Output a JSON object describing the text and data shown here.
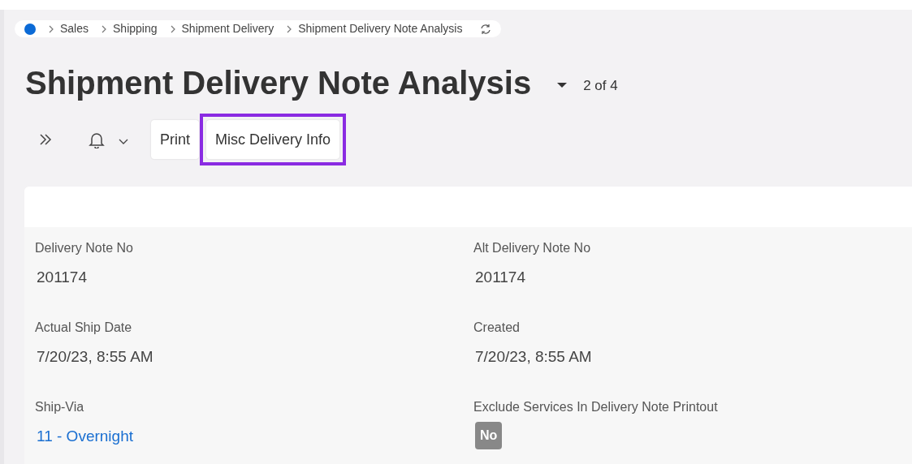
{
  "breadcrumb": [
    "Sales",
    "Shipping",
    "Shipment Delivery",
    "Shipment Delivery Note Analysis"
  ],
  "title": "Shipment Delivery Note Analysis",
  "record_position": "2 of 4",
  "toolbar": {
    "buttons": [
      {
        "label": "Print",
        "highlighted": false
      },
      {
        "label": "Misc Delivery Info",
        "highlighted": true
      }
    ]
  },
  "fields": [
    {
      "label": "Delivery Note No",
      "value": "201174",
      "kind": "text"
    },
    {
      "label": "Alt Delivery Note No",
      "value": "201174",
      "kind": "text"
    },
    {
      "label": "Actual Ship Date",
      "value": "7/20/23, 8:55 AM",
      "kind": "text"
    },
    {
      "label": "Created",
      "value": "7/20/23, 8:55 AM",
      "kind": "text"
    },
    {
      "label": "Ship-Via",
      "value": "11 - Overnight",
      "kind": "link"
    },
    {
      "label": "Exclude Services In Delivery Note Printout",
      "value": "No",
      "kind": "badge"
    }
  ]
}
